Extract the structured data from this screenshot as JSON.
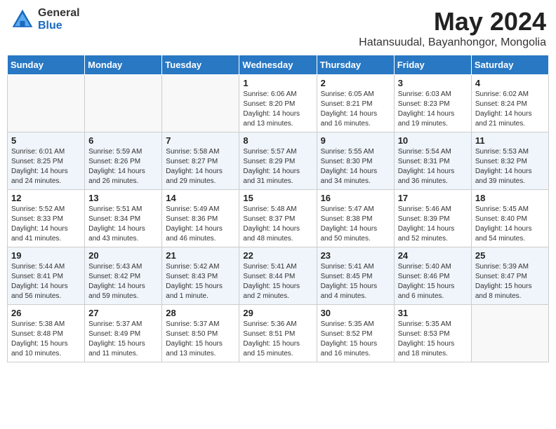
{
  "header": {
    "logo_general": "General",
    "logo_blue": "Blue",
    "month": "May 2024",
    "location": "Hatansuudal, Bayanhongor, Mongolia"
  },
  "days_of_week": [
    "Sunday",
    "Monday",
    "Tuesday",
    "Wednesday",
    "Thursday",
    "Friday",
    "Saturday"
  ],
  "weeks": [
    [
      {
        "day": "",
        "info": ""
      },
      {
        "day": "",
        "info": ""
      },
      {
        "day": "",
        "info": ""
      },
      {
        "day": "1",
        "info": "Sunrise: 6:06 AM\nSunset: 8:20 PM\nDaylight: 14 hours\nand 13 minutes."
      },
      {
        "day": "2",
        "info": "Sunrise: 6:05 AM\nSunset: 8:21 PM\nDaylight: 14 hours\nand 16 minutes."
      },
      {
        "day": "3",
        "info": "Sunrise: 6:03 AM\nSunset: 8:23 PM\nDaylight: 14 hours\nand 19 minutes."
      },
      {
        "day": "4",
        "info": "Sunrise: 6:02 AM\nSunset: 8:24 PM\nDaylight: 14 hours\nand 21 minutes."
      }
    ],
    [
      {
        "day": "5",
        "info": "Sunrise: 6:01 AM\nSunset: 8:25 PM\nDaylight: 14 hours\nand 24 minutes."
      },
      {
        "day": "6",
        "info": "Sunrise: 5:59 AM\nSunset: 8:26 PM\nDaylight: 14 hours\nand 26 minutes."
      },
      {
        "day": "7",
        "info": "Sunrise: 5:58 AM\nSunset: 8:27 PM\nDaylight: 14 hours\nand 29 minutes."
      },
      {
        "day": "8",
        "info": "Sunrise: 5:57 AM\nSunset: 8:29 PM\nDaylight: 14 hours\nand 31 minutes."
      },
      {
        "day": "9",
        "info": "Sunrise: 5:55 AM\nSunset: 8:30 PM\nDaylight: 14 hours\nand 34 minutes."
      },
      {
        "day": "10",
        "info": "Sunrise: 5:54 AM\nSunset: 8:31 PM\nDaylight: 14 hours\nand 36 minutes."
      },
      {
        "day": "11",
        "info": "Sunrise: 5:53 AM\nSunset: 8:32 PM\nDaylight: 14 hours\nand 39 minutes."
      }
    ],
    [
      {
        "day": "12",
        "info": "Sunrise: 5:52 AM\nSunset: 8:33 PM\nDaylight: 14 hours\nand 41 minutes."
      },
      {
        "day": "13",
        "info": "Sunrise: 5:51 AM\nSunset: 8:34 PM\nDaylight: 14 hours\nand 43 minutes."
      },
      {
        "day": "14",
        "info": "Sunrise: 5:49 AM\nSunset: 8:36 PM\nDaylight: 14 hours\nand 46 minutes."
      },
      {
        "day": "15",
        "info": "Sunrise: 5:48 AM\nSunset: 8:37 PM\nDaylight: 14 hours\nand 48 minutes."
      },
      {
        "day": "16",
        "info": "Sunrise: 5:47 AM\nSunset: 8:38 PM\nDaylight: 14 hours\nand 50 minutes."
      },
      {
        "day": "17",
        "info": "Sunrise: 5:46 AM\nSunset: 8:39 PM\nDaylight: 14 hours\nand 52 minutes."
      },
      {
        "day": "18",
        "info": "Sunrise: 5:45 AM\nSunset: 8:40 PM\nDaylight: 14 hours\nand 54 minutes."
      }
    ],
    [
      {
        "day": "19",
        "info": "Sunrise: 5:44 AM\nSunset: 8:41 PM\nDaylight: 14 hours\nand 56 minutes."
      },
      {
        "day": "20",
        "info": "Sunrise: 5:43 AM\nSunset: 8:42 PM\nDaylight: 14 hours\nand 59 minutes."
      },
      {
        "day": "21",
        "info": "Sunrise: 5:42 AM\nSunset: 8:43 PM\nDaylight: 15 hours\nand 1 minute."
      },
      {
        "day": "22",
        "info": "Sunrise: 5:41 AM\nSunset: 8:44 PM\nDaylight: 15 hours\nand 2 minutes."
      },
      {
        "day": "23",
        "info": "Sunrise: 5:41 AM\nSunset: 8:45 PM\nDaylight: 15 hours\nand 4 minutes."
      },
      {
        "day": "24",
        "info": "Sunrise: 5:40 AM\nSunset: 8:46 PM\nDaylight: 15 hours\nand 6 minutes."
      },
      {
        "day": "25",
        "info": "Sunrise: 5:39 AM\nSunset: 8:47 PM\nDaylight: 15 hours\nand 8 minutes."
      }
    ],
    [
      {
        "day": "26",
        "info": "Sunrise: 5:38 AM\nSunset: 8:48 PM\nDaylight: 15 hours\nand 10 minutes."
      },
      {
        "day": "27",
        "info": "Sunrise: 5:37 AM\nSunset: 8:49 PM\nDaylight: 15 hours\nand 11 minutes."
      },
      {
        "day": "28",
        "info": "Sunrise: 5:37 AM\nSunset: 8:50 PM\nDaylight: 15 hours\nand 13 minutes."
      },
      {
        "day": "29",
        "info": "Sunrise: 5:36 AM\nSunset: 8:51 PM\nDaylight: 15 hours\nand 15 minutes."
      },
      {
        "day": "30",
        "info": "Sunrise: 5:35 AM\nSunset: 8:52 PM\nDaylight: 15 hours\nand 16 minutes."
      },
      {
        "day": "31",
        "info": "Sunrise: 5:35 AM\nSunset: 8:53 PM\nDaylight: 15 hours\nand 18 minutes."
      },
      {
        "day": "",
        "info": ""
      }
    ]
  ]
}
